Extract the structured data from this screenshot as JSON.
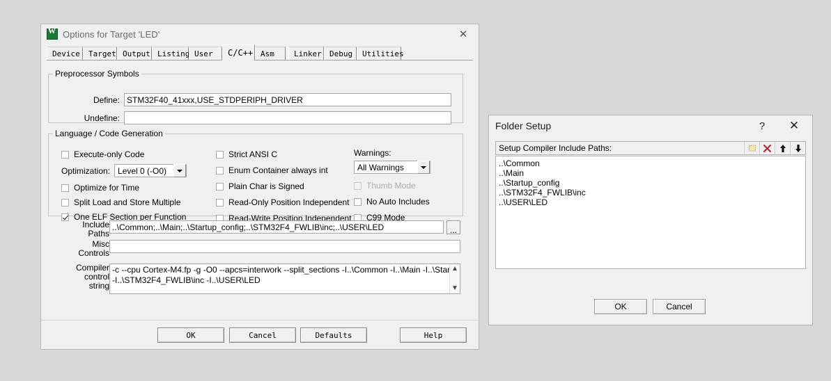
{
  "options_window": {
    "title": "Options for Target 'LED'",
    "icon": "keil-uvision-icon",
    "close_label": "✕",
    "tabs": [
      {
        "label": "Device",
        "active": false
      },
      {
        "label": "Target",
        "active": false
      },
      {
        "label": "Output",
        "active": false
      },
      {
        "label": "Listing",
        "active": false
      },
      {
        "label": "User",
        "active": false
      },
      {
        "label": "C/C++",
        "active": true
      },
      {
        "label": "Asm",
        "active": false
      },
      {
        "label": "Linker",
        "active": false
      },
      {
        "label": "Debug",
        "active": false
      },
      {
        "label": "Utilities",
        "active": false
      }
    ],
    "preprocessor": {
      "legend": "Preprocessor Symbols",
      "define_label": "Define:",
      "define_value": "STM32F40_41xxx,USE_STDPERIPH_DRIVER",
      "undefine_label": "Undefine:",
      "undefine_value": ""
    },
    "language": {
      "legend": "Language / Code Generation",
      "col1": [
        {
          "label": "Execute-only Code",
          "checked": false,
          "disabled": false
        },
        {
          "label": "Optimize for Time",
          "checked": false,
          "disabled": false
        },
        {
          "label": "Split Load and Store Multiple",
          "checked": false,
          "disabled": false
        },
        {
          "label": "One ELF Section per Function",
          "checked": true,
          "disabled": false
        }
      ],
      "optimization_label": "Optimization:",
      "optimization_value": "Level 0 (-O0)",
      "col2": [
        {
          "label": "Strict ANSI C",
          "checked": false,
          "disabled": false
        },
        {
          "label": "Enum Container always int",
          "checked": false,
          "disabled": false
        },
        {
          "label": "Plain Char is Signed",
          "checked": false,
          "disabled": false
        },
        {
          "label": "Read-Only Position Independent",
          "checked": false,
          "disabled": false
        },
        {
          "label": "Read-Write Position Independent",
          "checked": false,
          "disabled": false
        }
      ],
      "warnings_label": "Warnings:",
      "warnings_value": "All Warnings",
      "col3": [
        {
          "label": "Thumb Mode",
          "checked": false,
          "disabled": true
        },
        {
          "label": "No Auto Includes",
          "checked": false,
          "disabled": false
        },
        {
          "label": "C99 Mode",
          "checked": false,
          "disabled": false
        }
      ]
    },
    "include_paths_label_1": "Include",
    "include_paths_label_2": "Paths",
    "include_paths_value": "..\\Common;..\\Main;..\\Startup_config;..\\STM32F4_FWLIB\\inc;..\\USER\\LED",
    "browse_label": "...",
    "misc_label_1": "Misc",
    "misc_label_2": "Controls",
    "misc_value": "",
    "compiler_label_1": "Compiler",
    "compiler_label_2": "control",
    "compiler_label_3": "string",
    "compiler_value": "-c --cpu Cortex-M4.fp -g -O0 --apcs=interwork --split_sections -I..\\Common -I..\\Main -I..\\Startup_config\n-I..\\STM32F4_FWLIB\\inc -I..\\USER\\LED",
    "buttons": {
      "ok": "OK",
      "cancel": "Cancel",
      "defaults": "Defaults",
      "help": "Help"
    }
  },
  "folder_setup": {
    "title": "Folder Setup",
    "help_label": "?",
    "close_label": "✕",
    "bar_label": "Setup Compiler Include Paths:",
    "toolbar": [
      {
        "name": "new-folder-icon"
      },
      {
        "name": "delete-icon"
      },
      {
        "name": "move-up-icon"
      },
      {
        "name": "move-down-icon"
      }
    ],
    "paths": [
      "..\\Common",
      "..\\Main",
      "..\\Startup_config",
      "..\\STM32F4_FWLIB\\inc",
      "..\\USER\\LED"
    ],
    "buttons": {
      "ok": "OK",
      "cancel": "Cancel"
    }
  },
  "colors": {
    "desktop": "#d8d8d8",
    "dialog": "#f0f0f0",
    "delete_icon": "#c0252b",
    "keil_green": "#1a7a35"
  }
}
